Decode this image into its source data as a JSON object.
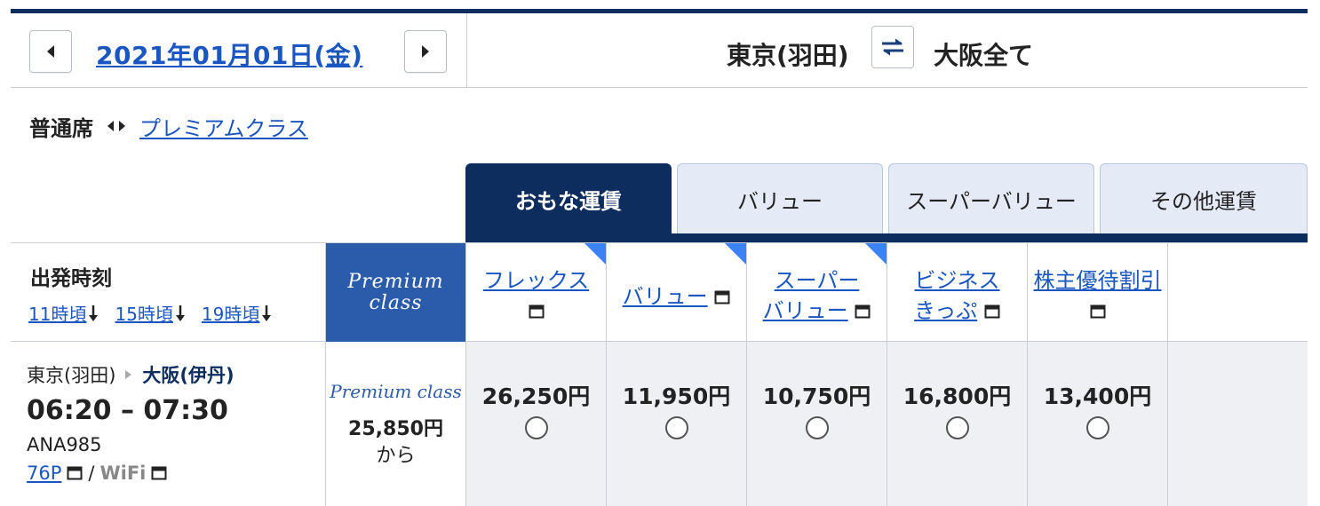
{
  "date_nav": {
    "prev_icon": "chevron-left-icon",
    "date_label": "2021年01月01日(金)",
    "next_icon": "chevron-right-icon"
  },
  "route": {
    "origin": "東京(羽田)",
    "swap_icon": "swap-arrows-icon",
    "destination": "大阪全て"
  },
  "seat_class": {
    "current": "普通席",
    "arrows_icon": "left-right-arrows-icon",
    "alternate": "プレミアムクラス"
  },
  "tabs": [
    {
      "label": "おもな運賃",
      "active": true
    },
    {
      "label": "バリュー",
      "active": false
    },
    {
      "label": "スーパーバリュー",
      "active": false
    },
    {
      "label": "その他運賃",
      "active": false
    }
  ],
  "table_header": {
    "departure_label": "出発時刻",
    "time_links": [
      {
        "label": "11時頃"
      },
      {
        "label": "15時頃"
      },
      {
        "label": "19時頃"
      }
    ],
    "premium_line1": "Premium",
    "premium_line2": "class",
    "fares": [
      {
        "line1": "フレックス",
        "line2": "",
        "corner": true
      },
      {
        "line1": "バリュー",
        "line2": "",
        "corner": true
      },
      {
        "line1": "スーパー",
        "line2": "バリュー",
        "corner": true
      },
      {
        "line1": "ビジネス",
        "line2": "きっぷ",
        "corner": false
      },
      {
        "line1": "株主優待割引",
        "line2": "",
        "corner": false
      }
    ]
  },
  "flight": {
    "origin": "東京(羽田)",
    "destination": "大阪(伊丹)",
    "time_range": "06:20 – 07:30",
    "flight_number": "ANA985",
    "aircraft": "76P",
    "separator": "/",
    "wifi": "WiFi",
    "premium_logo": "Premium class",
    "premium_price": "25,850円",
    "premium_from": "から",
    "prices": [
      "26,250円",
      "11,950円",
      "10,750円",
      "16,800円",
      "13,400円"
    ]
  },
  "colors": {
    "navy": "#0d2d5e",
    "link": "#1a56c2",
    "premium_blue": "#2a5cab",
    "corner_blue": "#3b82f6",
    "tab_inactive_bg": "#e4ebf6"
  }
}
